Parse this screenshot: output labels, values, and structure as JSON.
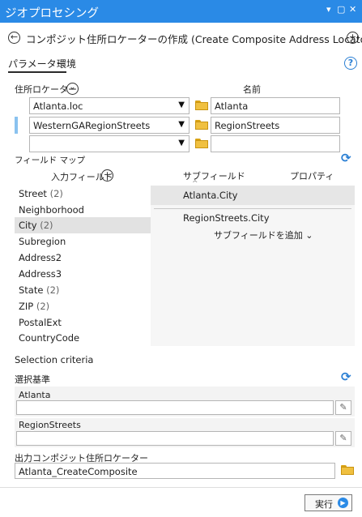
{
  "titlebar": {
    "title": "ジオプロセシング",
    "pin": "▾",
    "dock": "▢",
    "close": "✕"
  },
  "header": {
    "back_icon": "←",
    "tool_title": "コンポジット住所ロケーターの作成 (Create Composite Address Locator)",
    "add_icon": "+"
  },
  "tabs": [
    {
      "label": "パラメーター"
    },
    {
      "label": "環境"
    }
  ],
  "help_icon": "?",
  "locators": {
    "label": "住所ロケーター",
    "expand_icon": "⌄",
    "name_label": "名前",
    "rows": [
      {
        "locator": "Atlanta.loc",
        "name": "Atlanta"
      },
      {
        "locator": "WesternGARegionStreets",
        "name": "RegionStreets"
      },
      {
        "locator": "",
        "name": ""
      }
    ]
  },
  "field_map": {
    "label": "フィールド マップ",
    "input_header": "入力フィールド",
    "add_icon": "+",
    "subfield_header": "サブフィールド",
    "property_header": "プロパティ",
    "fields": [
      {
        "name": "Street",
        "count": "(2)"
      },
      {
        "name": "Neighborhood",
        "count": ""
      },
      {
        "name": "City",
        "count": "(2)"
      },
      {
        "name": "Subregion",
        "count": ""
      },
      {
        "name": "Address2",
        "count": ""
      },
      {
        "name": "Address3",
        "count": ""
      },
      {
        "name": "State",
        "count": "(2)"
      },
      {
        "name": "ZIP",
        "count": "(2)"
      },
      {
        "name": "PostalExt",
        "count": ""
      },
      {
        "name": "CountryCode",
        "count": ""
      }
    ],
    "subfields": [
      "Atlanta.City",
      "RegionStreets.City"
    ],
    "add_subfield": "サブフィールドを追加 ⌄"
  },
  "selection": {
    "heading": "Selection criteria",
    "label": "選択基準",
    "items": [
      {
        "name": "Atlanta",
        "value": ""
      },
      {
        "name": "RegionStreets",
        "value": ""
      }
    ]
  },
  "output": {
    "label": "出力コンポジット住所ロケーター",
    "value": "Atlanta_CreateComposite"
  },
  "run": {
    "label": "実行",
    "icon": "▶"
  }
}
